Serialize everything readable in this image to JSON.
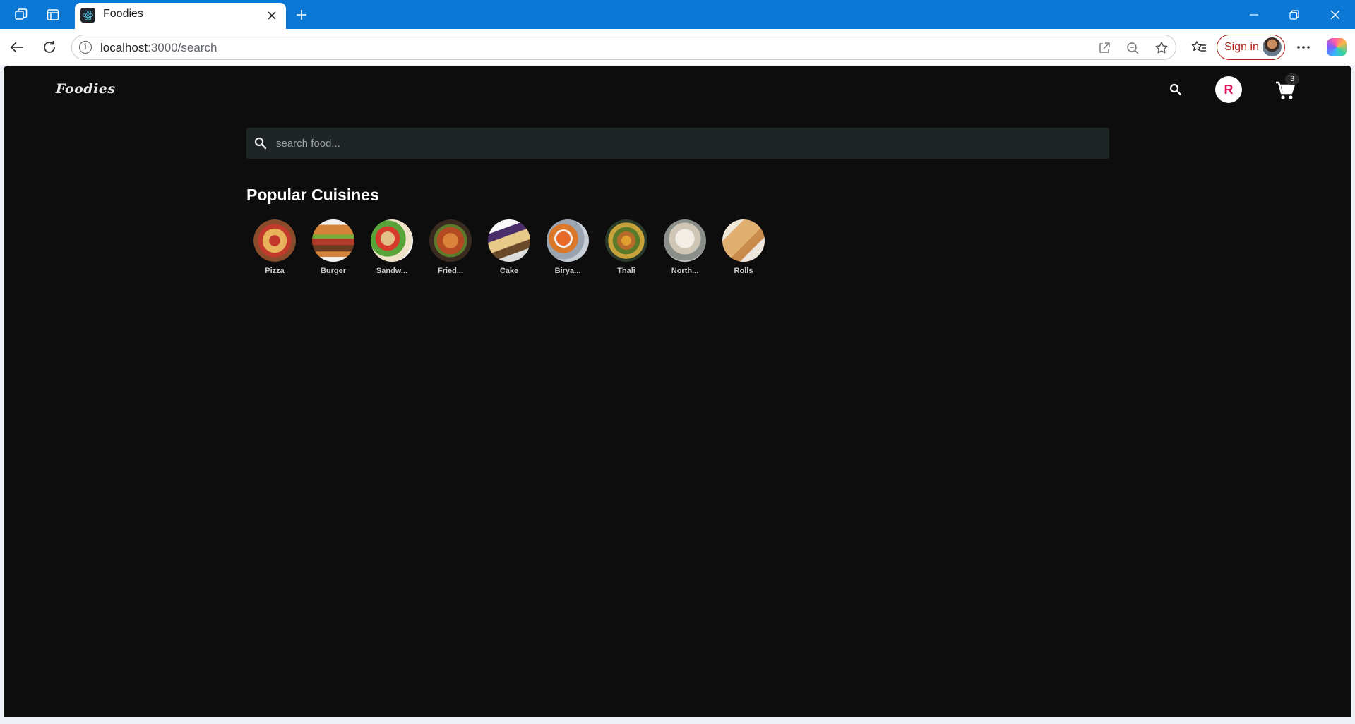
{
  "browser": {
    "tab_title": "Foodies",
    "url_host": "localhost",
    "url_path": ":3000/search",
    "signin_label": "Sign in"
  },
  "app": {
    "brand": "Foodies",
    "profile_initial": "R",
    "cart_count": "3",
    "search": {
      "placeholder": "search food..."
    },
    "section_title": "Popular Cuisines",
    "cuisines": [
      {
        "label": "Pizza",
        "image": "pizza"
      },
      {
        "label": "Burger",
        "image": "burger"
      },
      {
        "label": "Sandw...",
        "image": "sandwich"
      },
      {
        "label": "Fried...",
        "image": "fried"
      },
      {
        "label": "Cake",
        "image": "cake"
      },
      {
        "label": "Birya...",
        "image": "biryani"
      },
      {
        "label": "Thali",
        "image": "thali"
      },
      {
        "label": "North...",
        "image": "north-indian"
      },
      {
        "label": "Rolls",
        "image": "rolls"
      }
    ],
    "colors": {
      "background": "#0d0d0d",
      "search_bg": "#1f2426",
      "profile_text": "#e0115f",
      "browser_accent": "#0a78d4"
    }
  }
}
